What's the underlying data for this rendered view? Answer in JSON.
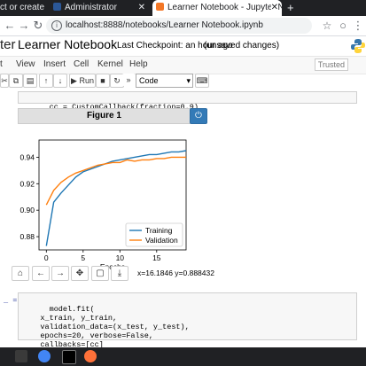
{
  "browser": {
    "tabs": [
      {
        "title": "ct or create a"
      },
      {
        "title": "Administrator"
      },
      {
        "title": "Learner Notebook - Jupyter No"
      }
    ],
    "new_tab_glyph": "+",
    "address": "localhost:8888/notebooks/Learner Notebook.ipynb"
  },
  "jupyter": {
    "logo_text": "ter",
    "notebook_title": "Learner Notebook",
    "checkpoint": "Last Checkpoint: an hour ago",
    "save_state": "(unsaved changes)",
    "trusted": "Trusted",
    "menus": [
      "t",
      "View",
      "Insert",
      "Cell",
      "Kernel",
      "Help"
    ],
    "toolbar": {
      "run_label": "Run",
      "cell_type": "Code"
    }
  },
  "cells": {
    "cell1": {
      "prompt": "",
      "code": "cc = CustomCallback(fraction=0.9)"
    },
    "cell2": {
      "prompt": "_ =",
      "code": "model.fit(\n    x_train, y_train,\n    validation_data=(x_test, y_test),\n    epochs=20, verbose=False,\n    callbacks=[cc]"
    }
  },
  "figure": {
    "title": "Figure 1",
    "close_glyph": "⏻",
    "coords": "x=16.1846 y=0.888432"
  },
  "chart_data": {
    "type": "line",
    "xlabel": "Epochs",
    "ylabel": "",
    "xlim": [
      -1,
      19
    ],
    "ylim": [
      0.87,
      0.953
    ],
    "xticks": [
      0,
      5,
      10,
      15
    ],
    "yticks": [
      0.88,
      0.9,
      0.92,
      0.94
    ],
    "ytick_labels": [
      "0.88",
      "0.90",
      "0.92",
      "0.94"
    ],
    "legend_position": "lower-right",
    "series": [
      {
        "name": "Training",
        "color": "#1f77b4",
        "x": [
          0,
          1,
          2,
          3,
          4,
          5,
          6,
          7,
          8,
          9,
          10,
          11,
          12,
          13,
          14,
          15,
          16,
          17,
          18,
          19
        ],
        "y": [
          0.873,
          0.906,
          0.913,
          0.919,
          0.925,
          0.929,
          0.931,
          0.933,
          0.935,
          0.937,
          0.938,
          0.939,
          0.94,
          0.941,
          0.942,
          0.942,
          0.943,
          0.944,
          0.944,
          0.945
        ]
      },
      {
        "name": "Validation",
        "color": "#ff7f0e",
        "x": [
          0,
          1,
          2,
          3,
          4,
          5,
          6,
          7,
          8,
          9,
          10,
          11,
          12,
          13,
          14,
          15,
          16,
          17,
          18,
          19
        ],
        "y": [
          0.904,
          0.915,
          0.921,
          0.925,
          0.928,
          0.93,
          0.932,
          0.934,
          0.935,
          0.936,
          0.936,
          0.938,
          0.937,
          0.938,
          0.938,
          0.939,
          0.939,
          0.94,
          0.94,
          0.94
        ]
      }
    ]
  },
  "colors": {
    "accent": "#337ab7",
    "tab_bg": "#202124"
  },
  "icons": [
    "info-icon",
    "back-icon",
    "forward-icon",
    "reload-icon",
    "home-icon",
    "move-icon",
    "zoom-icon",
    "save-icon",
    "python-logo-icon",
    "chrome-icon",
    "firefox-icon",
    "terminal-icon"
  ]
}
